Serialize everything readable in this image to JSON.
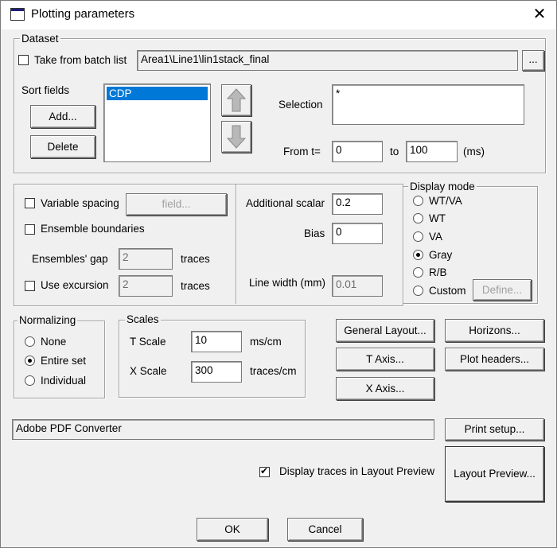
{
  "window": {
    "title": "Plotting parameters",
    "close_glyph": "✕"
  },
  "dataset": {
    "legend": "Dataset",
    "take_from_batch_label": "Take from batch list",
    "path_value": "Area1\\Line1\\lin1stack_final",
    "browse_label": "...",
    "sort_fields_label": "Sort fields",
    "sort_items": [
      "CDP"
    ],
    "add_label": "Add...",
    "delete_label": "Delete",
    "selection_label": "Selection",
    "selection_value": "*",
    "from_label": "From t=",
    "from_value": "0",
    "to_label": "to",
    "to_value": "100",
    "unit_ms": "(ms)"
  },
  "spacing": {
    "variable_spacing_label": "Variable spacing",
    "field_label": "field...",
    "ensemble_boundaries_label": "Ensemble boundaries",
    "ensembles_gap_label": "Ensembles' gap",
    "ensembles_gap_value": "2",
    "traces1": "traces",
    "use_excursion_label": "Use excursion",
    "excursion_value": "2",
    "traces2": "traces",
    "additional_scalar_label": "Additional scalar",
    "additional_scalar_value": "0.2",
    "bias_label": "Bias",
    "bias_value": "0",
    "line_width_label": "Line width (mm)",
    "line_width_value": "0.01"
  },
  "display_mode": {
    "legend": "Display mode",
    "options": [
      "WT/VA",
      "WT",
      "VA",
      "Gray",
      "R/B",
      "Custom"
    ],
    "selected": "Gray",
    "define_label": "Define..."
  },
  "normalizing": {
    "legend": "Normalizing",
    "options": [
      "None",
      "Entire set",
      "Individual"
    ],
    "selected": "Entire set"
  },
  "scales": {
    "legend": "Scales",
    "t_scale_label": "T Scale",
    "t_scale_value": "10",
    "t_unit": "ms/cm",
    "x_scale_label": "X Scale",
    "x_scale_value": "300",
    "x_unit": "traces/cm"
  },
  "buttons": {
    "general_layout": "General Layout...",
    "horizons": "Horizons...",
    "t_axis": "T Axis...",
    "plot_headers": "Plot headers...",
    "x_axis": "X Axis...",
    "print_setup": "Print setup...",
    "layout_preview": "Layout Preview...",
    "ok": "OK",
    "cancel": "Cancel"
  },
  "printer": {
    "name": "Adobe PDF Converter"
  },
  "preview": {
    "display_traces_label": "Display traces in Layout Preview",
    "checked": true
  }
}
